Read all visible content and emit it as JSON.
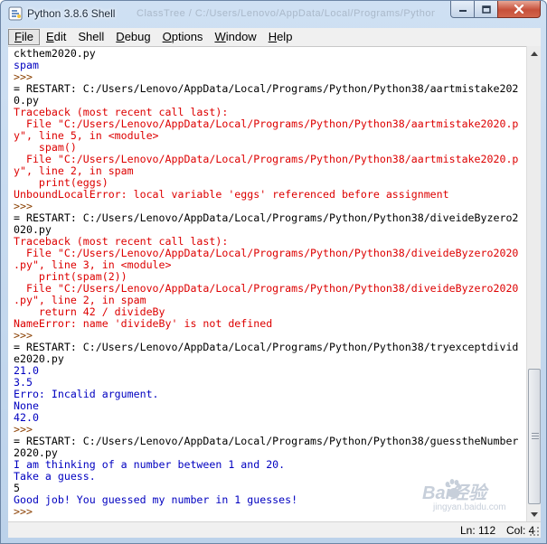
{
  "window": {
    "title": "Python 3.8.6 Shell",
    "title_ghost": "ClassTree / C:/Users/Lenovo/AppData/Local/Programs/Python"
  },
  "menu": [
    {
      "label": "File",
      "accel": "F",
      "rest": "ile"
    },
    {
      "label": "Edit",
      "accel": "E",
      "rest": "dit"
    },
    {
      "label": "Shell",
      "accel": "S",
      "rest": "hell"
    },
    {
      "label": "Debug",
      "accel": "D",
      "rest": "ebug"
    },
    {
      "label": "Options",
      "accel": "O",
      "rest": "ptions"
    },
    {
      "label": "Window",
      "accel": "W",
      "rest": "indow"
    },
    {
      "label": "Help",
      "accel": "H",
      "rest": "elp"
    }
  ],
  "shell": {
    "lines": [
      {
        "text": "ckthem2020.py",
        "color": "black"
      },
      {
        "text": "spam",
        "color": "blue"
      },
      {
        "text": ">>> ",
        "color": "prompt"
      },
      {
        "text": "= RESTART: C:/Users/Lenovo/AppData/Local/Programs/Python/Python38/aartmistake202",
        "color": "black"
      },
      {
        "text": "0.py",
        "color": "black"
      },
      {
        "text": "Traceback (most recent call last):",
        "color": "red"
      },
      {
        "text": "  File \"C:/Users/Lenovo/AppData/Local/Programs/Python/Python38/aartmistake2020.p",
        "color": "red"
      },
      {
        "text": "y\", line 5, in <module>",
        "color": "red"
      },
      {
        "text": "    spam()",
        "color": "red"
      },
      {
        "text": "  File \"C:/Users/Lenovo/AppData/Local/Programs/Python/Python38/aartmistake2020.p",
        "color": "red"
      },
      {
        "text": "y\", line 2, in spam",
        "color": "red"
      },
      {
        "text": "    print(eggs)",
        "color": "red"
      },
      {
        "text": "UnboundLocalError: local variable 'eggs' referenced before assignment",
        "color": "red"
      },
      {
        "text": ">>> ",
        "color": "prompt"
      },
      {
        "text": "= RESTART: C:/Users/Lenovo/AppData/Local/Programs/Python/Python38/diveideByzero2",
        "color": "black"
      },
      {
        "text": "020.py",
        "color": "black"
      },
      {
        "text": "Traceback (most recent call last):",
        "color": "red"
      },
      {
        "text": "  File \"C:/Users/Lenovo/AppData/Local/Programs/Python/Python38/diveideByzero2020",
        "color": "red"
      },
      {
        "text": ".py\", line 3, in <module>",
        "color": "red"
      },
      {
        "text": "    print(spam(2))",
        "color": "red"
      },
      {
        "text": "  File \"C:/Users/Lenovo/AppData/Local/Programs/Python/Python38/diveideByzero2020",
        "color": "red"
      },
      {
        "text": ".py\", line 2, in spam",
        "color": "red"
      },
      {
        "text": "    return 42 / divideBy",
        "color": "red"
      },
      {
        "text": "NameError: name 'divideBy' is not defined",
        "color": "red"
      },
      {
        "text": ">>> ",
        "color": "prompt"
      },
      {
        "text": "= RESTART: C:/Users/Lenovo/AppData/Local/Programs/Python/Python38/tryexceptdivid",
        "color": "black"
      },
      {
        "text": "e2020.py",
        "color": "black"
      },
      {
        "text": "21.0",
        "color": "blue"
      },
      {
        "text": "3.5",
        "color": "blue"
      },
      {
        "text": "Erro: Incalid argument.",
        "color": "blue"
      },
      {
        "text": "None",
        "color": "blue"
      },
      {
        "text": "42.0",
        "color": "blue"
      },
      {
        "text": ">>> ",
        "color": "prompt"
      },
      {
        "text": "= RESTART: C:/Users/Lenovo/AppData/Local/Programs/Python/Python38/guesstheNumber",
        "color": "black"
      },
      {
        "text": "2020.py",
        "color": "black"
      },
      {
        "text": "I am thinking of a number between 1 and 20.",
        "color": "blue"
      },
      {
        "text": "Take a guess.",
        "color": "blue"
      },
      {
        "text": "5",
        "color": "black"
      },
      {
        "text": "Good job! You guessed my number in 1 guesses!",
        "color": "blue"
      },
      {
        "text": ">>> ",
        "color": "prompt"
      }
    ]
  },
  "status": {
    "line": "Ln: 112",
    "col": "Col: 4"
  },
  "watermark": {
    "text": "Bai经验",
    "subtext": "jingyan.baidu.com"
  },
  "colors": {
    "black": "#000000",
    "red": "#dd0000",
    "blue": "#0000c0",
    "prompt": "#8a3f00"
  }
}
